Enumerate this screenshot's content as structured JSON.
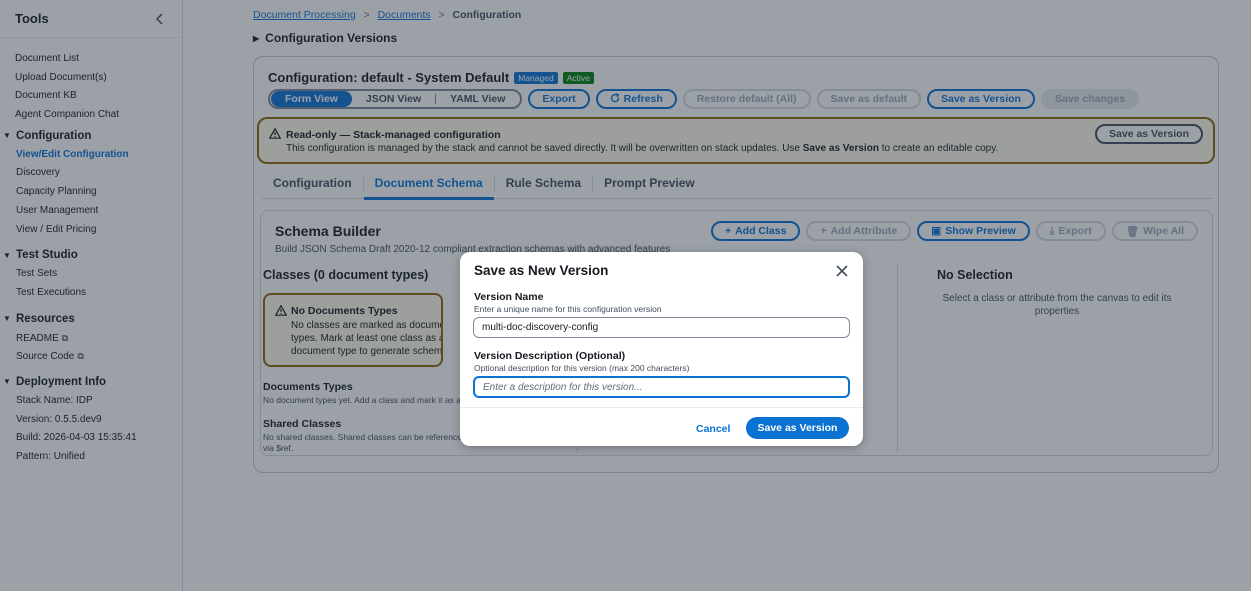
{
  "sidebar": {
    "title": "Tools",
    "links": [
      "Document List",
      "Upload Document(s)",
      "Document KB",
      "Agent Companion Chat"
    ],
    "sections": [
      {
        "label": "Configuration",
        "items": [
          "View/Edit Configuration",
          "Discovery",
          "Capacity Planning",
          "User Management",
          "View / Edit Pricing"
        ]
      },
      {
        "label": "Test Studio",
        "items": [
          "Test Sets",
          "Test Executions"
        ]
      },
      {
        "label": "Resources",
        "items": [
          "README",
          "Source Code"
        ]
      },
      {
        "label": "Deployment Info",
        "items": [
          "Stack Name: IDP",
          "Version: 0.5.5.dev9",
          "Build: 2026-04-03 15:35:41",
          "Pattern: Unified"
        ]
      }
    ]
  },
  "breadcrumb": {
    "items": [
      "Document Processing",
      "Documents"
    ],
    "current": "Configuration"
  },
  "versions_toggle": "Configuration Versions",
  "config": {
    "title": "Configuration: default - System Default",
    "badge_managed": "Managed",
    "badge_active": "Active",
    "views": [
      "Form View",
      "JSON View",
      "YAML View"
    ],
    "buttons": {
      "export": "Export",
      "refresh": "Refresh",
      "restore": "Restore default (All)",
      "save_default": "Save as default",
      "save_version": "Save as Version",
      "save_changes": "Save changes"
    }
  },
  "alert": {
    "title": "Read-only — Stack-managed configuration",
    "body_pre": "This configuration is managed by the stack and cannot be saved directly. It will be overwritten on stack updates. Use ",
    "body_bold": "Save as Version",
    "body_post": " to create an editable copy.",
    "button": "Save as Version"
  },
  "tabs": [
    "Configuration",
    "Document Schema",
    "Rule Schema",
    "Prompt Preview"
  ],
  "schema": {
    "title": "Schema Builder",
    "subtitle": "Build JSON Schema Draft 2020-12 compliant extraction schemas with advanced features",
    "actions": {
      "add_class": "Add Class",
      "add_attribute": "Add Attribute",
      "show_preview": "Show Preview",
      "export": "Export",
      "wipe_all": "Wipe All"
    },
    "classes_heading": "Classes (0 document types)",
    "no_docs_title": "No Documents Types",
    "no_docs_body": "No classes are marked as document types. Mark at least one class as a document type to generate schemas.",
    "doc_types_heading": "Documents Types",
    "doc_types_body": "No document types yet. Add a class and mark it as a document type.",
    "shared_heading": "Shared Classes",
    "shared_body": "No shared classes. Shared classes can be referenced via $ref.",
    "no_selection_heading": "No Selection",
    "no_selection_body": "Select a class or attribute from the canvas to edit its properties"
  },
  "modal": {
    "title": "Save as New Version",
    "name_label": "Version Name",
    "name_desc": "Enter a unique name for this configuration version",
    "name_value": "multi-doc-discovery-config",
    "desc_label": "Version Description (Optional)",
    "desc_desc": "Optional description for this version (max 200 characters)",
    "desc_placeholder": "Enter a description for this version...",
    "cancel": "Cancel",
    "submit": "Save as Version"
  },
  "colors": {
    "primary": "#0972d3",
    "warning": "#8d6605",
    "success": "#037f0c"
  }
}
